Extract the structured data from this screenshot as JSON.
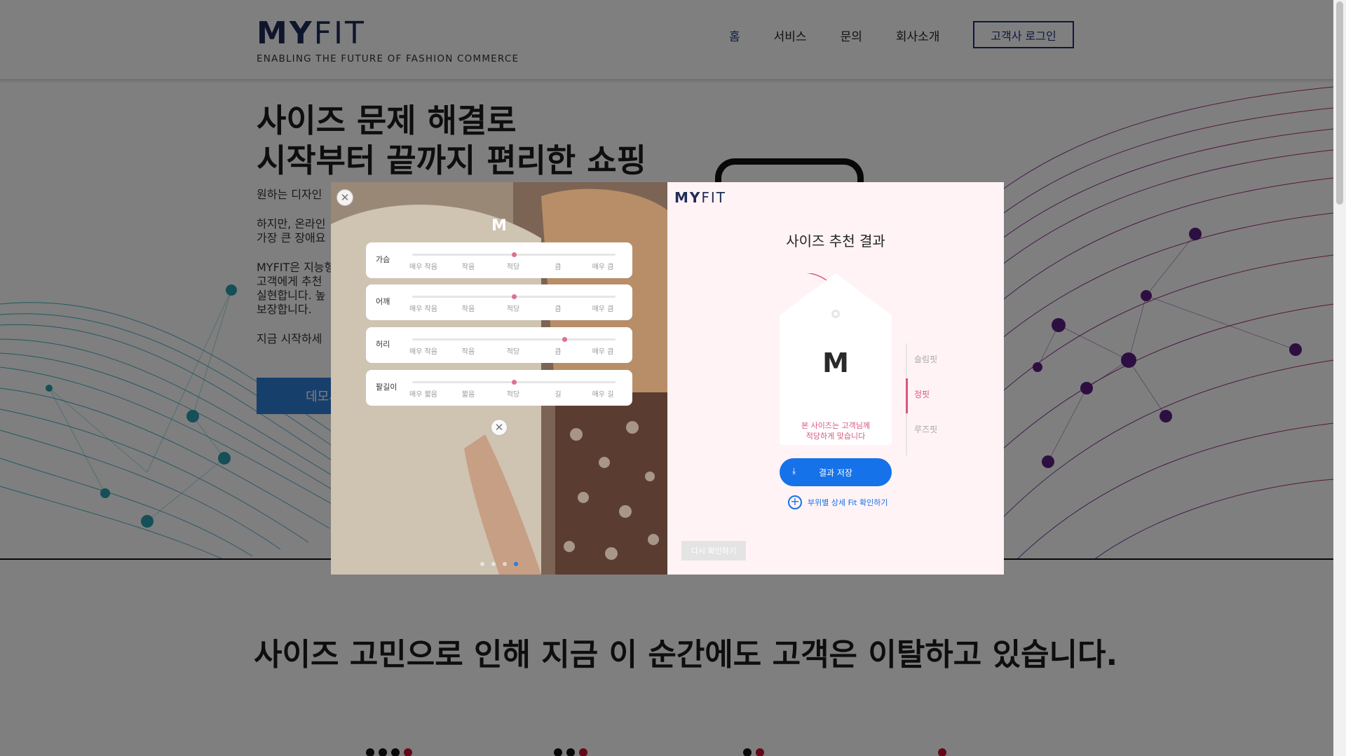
{
  "header": {
    "logo_my": "MY",
    "logo_fit": "FIT",
    "tagline": "ENABLING THE FUTURE OF FASHION COMMERCE",
    "nav": [
      "홈",
      "서비스",
      "문의",
      "회사소개"
    ],
    "login_label": "고객사 로그인",
    "accent_color": "#1b2f86"
  },
  "hero": {
    "title_line1": "사이즈 문제 해결로",
    "title_line2": "시작부터 끝까지 편리한 쇼핑",
    "p1": "원하는 디자인",
    "p2a": "하지만, 온라인",
    "p2b": "가장 큰 장애요",
    "p3a": "MYFIT은 지능형",
    "p3b": "고객에게 추천",
    "p3c": "실현합니다. 높",
    "p3d": "보장합니다.",
    "p4": "지금 시작하세",
    "demo_label": "데모시"
  },
  "section": {
    "title": "사이즈 고민으로 인해 지금 이 순간에도 고객은 이탈하고 있습니다."
  },
  "modal": {
    "size": "M",
    "close_icon": "close-icon",
    "rows": [
      {
        "label": "가슴",
        "ticks": [
          "매우 작음",
          "작음",
          "적당",
          "큼",
          "매우 큼"
        ],
        "level": 2
      },
      {
        "label": "어깨",
        "ticks": [
          "매우 작음",
          "작음",
          "적당",
          "큼",
          "매우 큼"
        ],
        "level": 2
      },
      {
        "label": "허리",
        "ticks": [
          "매우 작음",
          "작음",
          "적당",
          "큼",
          "매우 큼"
        ],
        "level": 3
      },
      {
        "label": "팔길이",
        "ticks": [
          "매우 짧음",
          "짧음",
          "적당",
          "길",
          "매우 길"
        ],
        "level": 2
      }
    ],
    "pager_active": 4,
    "pager_count": 4,
    "right": {
      "logo_my": "MY",
      "logo_fit": "FIT",
      "title": "사이즈 추천 결과",
      "size": "M",
      "msg_line1": "본 사이즈는 고객님께",
      "msg_line2": "적당하게 맞습니다",
      "fit_options": [
        "슬림핏",
        "정핏",
        "루즈핏"
      ],
      "fit_active": 1,
      "save_label": "결과 저장",
      "detail_label": "부위별 상세 Fit 확인하기",
      "retry_label": "다시 확인하기",
      "accent_pink": "#d9577d",
      "accent_blue": "#1672e8"
    }
  }
}
